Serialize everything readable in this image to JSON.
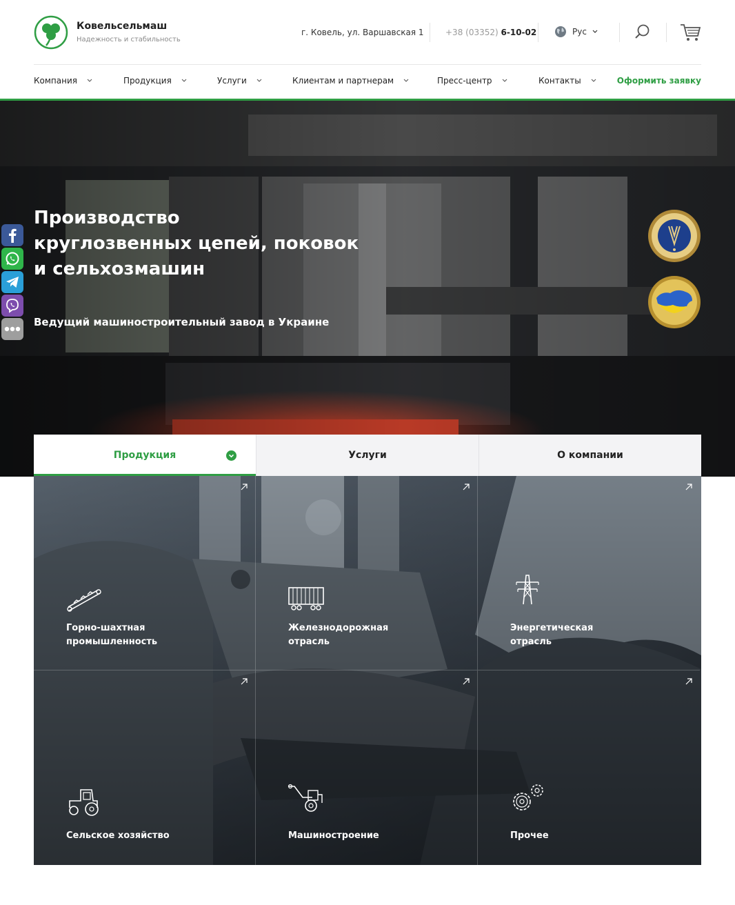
{
  "header": {
    "brand_name": "Ковельсельмаш",
    "brand_tagline": "Надежность и стабильность",
    "address": "г. Ковель, ул. Варшавская 1",
    "phone_prefix": "+38 (03352)",
    "phone_number": "6-10-02",
    "language": "Рус",
    "icons": {
      "logo": "clover-logo-icon",
      "language": "globe-icon",
      "search": "search-icon",
      "cart": "cart-icon"
    }
  },
  "nav": {
    "items": [
      {
        "label": "Компания"
      },
      {
        "label": "Продукция"
      },
      {
        "label": "Услуги"
      },
      {
        "label": "Клиентам и партнерам"
      },
      {
        "label": "Пресс-центр"
      },
      {
        "label": "Контакты"
      }
    ],
    "cta": "Оформить заявку"
  },
  "hero": {
    "title_line1": "Производство",
    "title_line2": "круглозвенных цепей, поковок",
    "title_line3": "и сельхозмашин",
    "subtitle": "Ведущий машиностроительный завод в Украине",
    "medals": [
      "quality-medal-icon",
      "ukraine-map-medal-icon"
    ]
  },
  "social": [
    "facebook-icon",
    "whatsapp-icon",
    "telegram-icon",
    "viber-icon",
    "more-icon"
  ],
  "tabs": [
    {
      "label": "Продукция",
      "active": true
    },
    {
      "label": "Услуги",
      "active": false
    },
    {
      "label": "О компании",
      "active": false
    }
  ],
  "categories": [
    {
      "line1": "Горно-шахтная",
      "line2": "промышленность",
      "icon": "conveyor-icon"
    },
    {
      "line1": "Железнодорожная",
      "line2": "отрасль",
      "icon": "railcar-icon"
    },
    {
      "line1": "Энергетическая",
      "line2": "отрасль",
      "icon": "power-tower-icon"
    },
    {
      "line1": "Сельское хозяйство",
      "line2": "",
      "icon": "tractor-icon"
    },
    {
      "line1": "Машиностроение",
      "line2": "",
      "icon": "cultivator-icon"
    },
    {
      "line1": "Прочее",
      "line2": "",
      "icon": "gears-icon"
    }
  ],
  "colors": {
    "accent": "#2f9e44",
    "text": "#222222",
    "muted": "#8a8a8a",
    "tab_bg": "#f3f3f5"
  }
}
